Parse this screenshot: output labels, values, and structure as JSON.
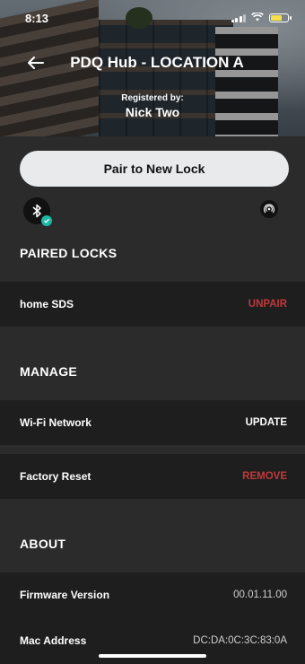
{
  "status_bar": {
    "time": "8:13"
  },
  "header": {
    "title": "PDQ Hub - LOCATION A",
    "registered_label": "Registered by:",
    "registered_name": "Nick Two"
  },
  "actions": {
    "pair_button": "Pair to New Lock"
  },
  "paired_locks": {
    "heading": "PAIRED LOCKS",
    "items": [
      {
        "name": "home SDS",
        "action": "UNPAIR"
      }
    ]
  },
  "manage": {
    "heading": "MANAGE",
    "wifi_label": "Wi-Fi Network",
    "wifi_action": "UPDATE",
    "reset_label": "Factory Reset",
    "reset_action": "REMOVE"
  },
  "about": {
    "heading": "ABOUT",
    "firmware_label": "Firmware Version",
    "firmware_value": "00.01.11.00",
    "mac_label": "Mac Address",
    "mac_value": "DC:DA:0C:3C:83:0A"
  },
  "colors": {
    "background": "#2b2b2b",
    "row_background": "#1e1e1e",
    "danger": "#c0393b",
    "accent_teal": "#1fb7a5",
    "button_bg": "#e8eaec"
  }
}
